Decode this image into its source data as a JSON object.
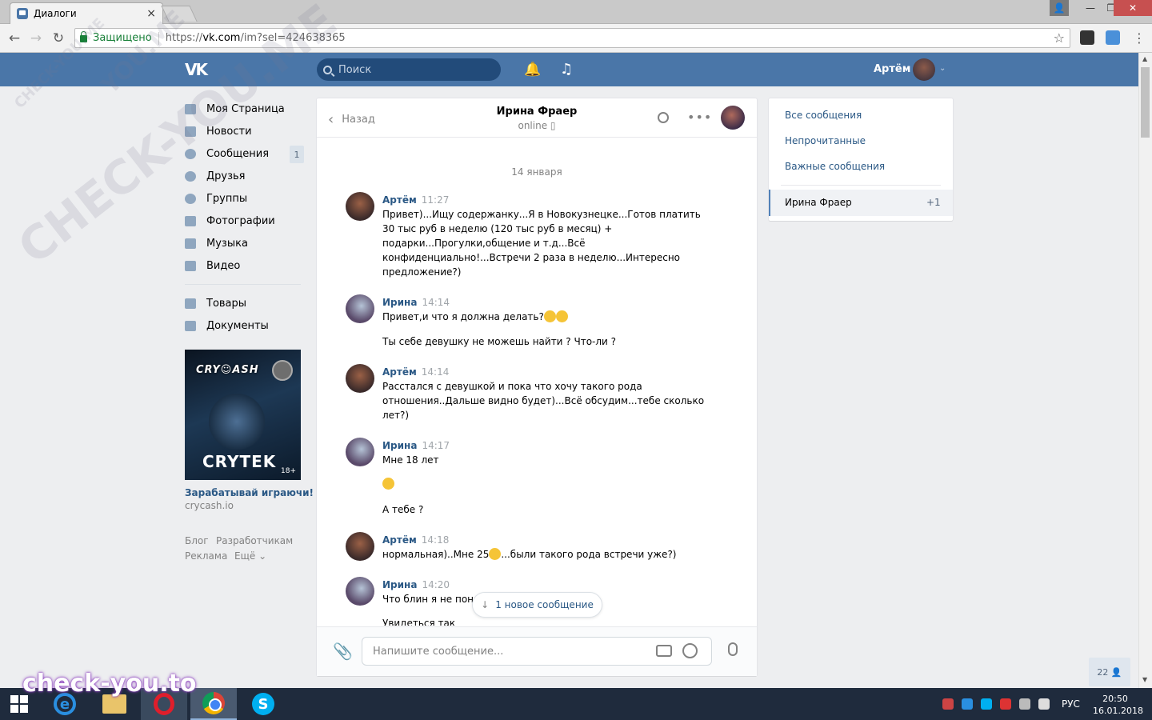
{
  "browser": {
    "tab_title": "Диалоги",
    "tab_close": "×",
    "secure_label": "Защищено",
    "url_scheme": "https://",
    "url_host": "vk.com",
    "url_path": "/im?sel=424638365",
    "star_icon": "☆",
    "back_icon": "←",
    "forward_icon": "→",
    "reload_icon": "↻",
    "menu_icon": "⋮",
    "window_min": "—",
    "window_max": "❐",
    "window_close": "✕",
    "window_user": "👤"
  },
  "vk_header": {
    "logo": "VK",
    "search_placeholder": "Поиск",
    "bell_icon": "🔔",
    "music_icon": "♫",
    "user_name": "Артём",
    "chevron": "⌄"
  },
  "left_nav": {
    "items": [
      {
        "label": "Моя Страница",
        "icon": "home-icon"
      },
      {
        "label": "Новости",
        "icon": "news-icon"
      },
      {
        "label": "Сообщения",
        "icon": "messages-icon",
        "badge": "1"
      },
      {
        "label": "Друзья",
        "icon": "friends-icon"
      },
      {
        "label": "Группы",
        "icon": "groups-icon"
      },
      {
        "label": "Фотографии",
        "icon": "photos-icon"
      },
      {
        "label": "Музыка",
        "icon": "music-icon"
      },
      {
        "label": "Видео",
        "icon": "video-icon"
      },
      {
        "label": "Товары",
        "icon": "market-icon"
      },
      {
        "label": "Документы",
        "icon": "documents-icon"
      }
    ],
    "ad": {
      "image_text": "CRY☺ASH",
      "image_logo": "CRYTEK",
      "image_age": "18+",
      "title": "Зарабатывай играючи!",
      "domain": "crycash.io"
    },
    "footer": {
      "blog": "Блог",
      "developers": "Разработчикам",
      "ads": "Реклама",
      "more": "Ещё ⌄"
    }
  },
  "dialog": {
    "back_label": "Назад",
    "back_icon": "‹",
    "contact_name": "Ирина Фраер",
    "contact_status": "online ▯",
    "more_icon": "•••",
    "date_separator": "14 января",
    "messages": [
      {
        "author": "Артём",
        "time": "11:27",
        "lines": [
          "Привет)...Ищу содержанку...Я в Новокузнецке...Готов платить",
          "30 тыс руб в неделю (120 тыс руб в месяц) +",
          "подарки...Прогулки,общение и т.д...Всё",
          "конфиденциально!...Встречи 2 раза в неделю...Интересно",
          "предложение?)"
        ]
      },
      {
        "author": "Ирина",
        "time": "14:14",
        "lines": [
          "Привет,и что я должна делать?",
          "Ты себе девушку не можешь найти ? Что-ли ?"
        ]
      },
      {
        "author": "Артём",
        "time": "14:14",
        "lines": [
          "Расстался с девушкой и пока что хочу такого рода",
          "отношения..Дальше видно будет)...Всё обсудим...тебе сколько",
          "лет?)"
        ]
      },
      {
        "author": "Ирина",
        "time": "14:17",
        "lines": [
          "Мне 18 лет",
          "А тебе ?"
        ]
      },
      {
        "author": "Артём",
        "time": "14:18",
        "lines": [
          "нормальная)..Мне 25",
          "...были такого рода встречи уже?)"
        ]
      },
      {
        "author": "Ирина",
        "time": "14:20",
        "lines": [
          "Что блин я не пон",
          "Увидеться так"
        ]
      }
    ],
    "new_message_label": "1 новое сообщение",
    "new_message_icon": "↓",
    "input_placeholder": "Напишите сообщение...",
    "attach_icon": "📎"
  },
  "right_panel": {
    "all_messages": "Все сообщения",
    "unread": "Непрочитанные",
    "important": "Важные сообщения",
    "active_dialog": "Ирина Фраер",
    "active_count": "+1"
  },
  "online_count": "22 👤",
  "watermarks": {
    "big": "CHECK-YOU.ME",
    "small": "CHECK-YOU.ME",
    "mid": "YOU.ME",
    "bottom": "check-you.to"
  },
  "taskbar": {
    "lang": "РУС",
    "time": "20:50",
    "date": "16.01.2018",
    "ie_letter": "e",
    "skype_letter": "S"
  }
}
